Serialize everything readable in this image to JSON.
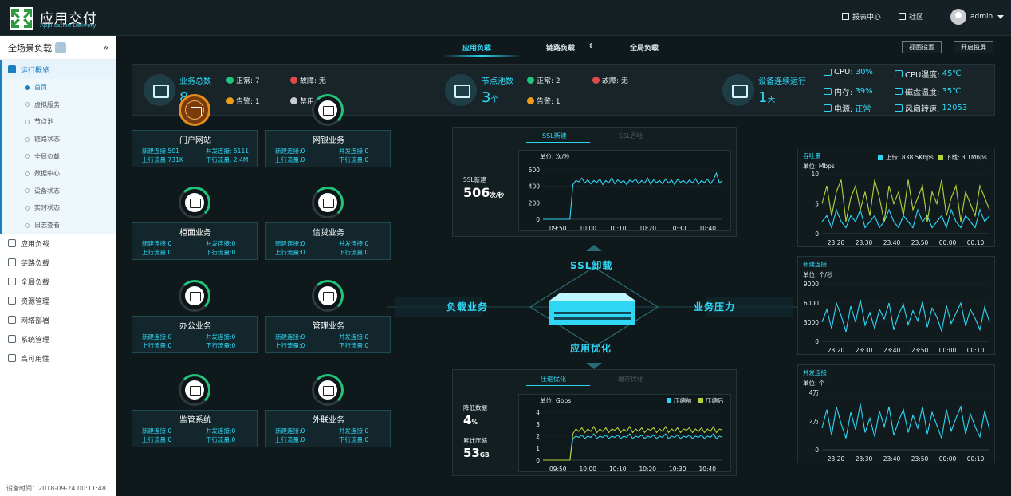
{
  "app": {
    "title": "应用交付",
    "subtitle": "Application Delivery"
  },
  "topbar": {
    "report": "报表中心",
    "community": "社区",
    "user": "admin"
  },
  "sidebar": {
    "header": "全场景负载",
    "collapse": "«",
    "groups": [
      {
        "label": "运行概览",
        "active": true
      },
      {
        "label": "应用负载"
      },
      {
        "label": "链路负载"
      },
      {
        "label": "全局负载"
      },
      {
        "label": "资源管理"
      },
      {
        "label": "网络部署"
      },
      {
        "label": "系统管理"
      },
      {
        "label": "高可用性"
      }
    ],
    "subitems": [
      "首页",
      "虚拟服务",
      "节点池",
      "链路状态",
      "全局负载",
      "数据中心",
      "设备状态",
      "实时状态",
      "日志查看"
    ],
    "footer": "设备时间：2018-09-24 00:11:48"
  },
  "tabs": {
    "app": "应用负载",
    "link": "链路负载",
    "global": "全局负载",
    "btn_view": "视图设置",
    "btn_screen": "开启投屏"
  },
  "stats": {
    "biz_label": "业务总数",
    "biz_value": "8",
    "biz_unit": "个",
    "normal": "正常: 7",
    "fault": "故障: 无",
    "warn": "告警: 1",
    "disabled": "禁用: 无",
    "pool_label": "节点池数",
    "pool_value": "3",
    "pool_unit": "个",
    "pool_normal": "正常: 2",
    "pool_fault": "故障: 无",
    "pool_warn": "告警: 1",
    "uptime_label": "设备连续运行",
    "uptime_value": "1",
    "uptime_unit": "天",
    "cpu_label": "CPU:",
    "cpu_value": "30%",
    "cputemp_label": "CPU温度:",
    "cputemp_value": "45℃",
    "mem_label": "内存:",
    "mem_value": "39%",
    "disk_label": "磁盘温度:",
    "disk_value": "35℃",
    "power_label": "电源:",
    "power_value": "正常",
    "fan_label": "风扇转速:",
    "fan_value": "12053"
  },
  "business": [
    {
      "name": "门户网站",
      "l1": "新建连接:501",
      "l2": "并发连接: 5111",
      "l3": "上行流量:731K",
      "l4": "下行流量: 2.4M"
    },
    {
      "name": "网银业务",
      "l1": "新建连接:0",
      "l2": "并发连接:0",
      "l3": "上行流量:0",
      "l4": "下行流量:0"
    },
    {
      "name": "柜面业务",
      "l1": "新建连接:0",
      "l2": "并发连接:0",
      "l3": "上行流量:0",
      "l4": "下行流量:0"
    },
    {
      "name": "信贷业务",
      "l1": "新建连接:0",
      "l2": "并发连接:0",
      "l3": "上行流量:0",
      "l4": "下行流量:0"
    },
    {
      "name": "办公业务",
      "l1": "新建连接:0",
      "l2": "并发连接:0",
      "l3": "上行流量:0",
      "l4": "下行流量:0"
    },
    {
      "name": "管理业务",
      "l1": "新建连接:0",
      "l2": "并发连接:0",
      "l3": "上行流量:0",
      "l4": "下行流量:0"
    },
    {
      "name": "监管系统",
      "l1": "新建连接:0",
      "l2": "并发连接:0",
      "l3": "上行流量:0",
      "l4": "下行流量:0"
    },
    {
      "name": "外联业务",
      "l1": "新建连接:0",
      "l2": "并发连接:0",
      "l3": "上行流量:0",
      "l4": "下行流量:0"
    }
  ],
  "center": {
    "ssl_tab_on": "SSL新建",
    "ssl_tab_off": "SSL吞吐",
    "ssl_label": "SSL新建",
    "ssl_value": "506",
    "ssl_unit": "次/秒",
    "ssl_offload": "SSL卸载",
    "load_biz": "负载业务",
    "biz_pressure": "业务压力",
    "app_opt": "应用优化",
    "comp_tab_on": "压缩优化",
    "comp_tab_off": "缓存优化",
    "reduce_label": "降低数据",
    "reduce_value": "4",
    "reduce_unit": "%",
    "total_label": "累计压缩",
    "total_value": "53",
    "total_unit": "GB"
  },
  "right": {
    "throughput_title": "吞吐量",
    "throughput_unit": "单位: Mbps",
    "up_legend": "上传: 838.5Kbps",
    "down_legend": "下载: 3.1Mbps",
    "newconn_title": "新建连接",
    "newconn_unit": "单位: 个/秒",
    "concur_title": "并发连接",
    "concur_unit": "单位: 个"
  },
  "colors": {
    "accent": "#2fd7f5",
    "green": "#22c37a",
    "yellow": "#b7d33b",
    "warn": "#f09c1a",
    "fault": "#e04a4a"
  },
  "chart_data": [
    {
      "type": "line",
      "title": "SSL新建",
      "ylabel": "单位: 次/秒",
      "ylim": [
        0,
        600
      ],
      "yticks": [
        0,
        200,
        400,
        600
      ],
      "xticks": [
        "09:50",
        "10:00",
        "10:10",
        "10:20",
        "10:30",
        "10:40"
      ],
      "series": [
        {
          "values": [
            0,
            0,
            0,
            0,
            0,
            0,
            0,
            0,
            0,
            0,
            420,
            470,
            455,
            500,
            440,
            480,
            430,
            470,
            445,
            490,
            420,
            470,
            440,
            505,
            430,
            480,
            445,
            470,
            420,
            475,
            455,
            490,
            430,
            470,
            440,
            500,
            425,
            480,
            445,
            470,
            430,
            490,
            440,
            475,
            420,
            485,
            450,
            470,
            430,
            480,
            440,
            495,
            425,
            470,
            445,
            490,
            430,
            480,
            560,
            440,
            470
          ]
        }
      ]
    },
    {
      "type": "line",
      "ylabel": "单位: Gbps",
      "ylim": [
        0,
        4
      ],
      "yticks": [
        0,
        1,
        2,
        3,
        4
      ],
      "xticks": [
        "09:50",
        "10:00",
        "10:10",
        "10:20",
        "10:30",
        "10:40"
      ],
      "series": [
        {
          "name": "压缩前",
          "values": [
            0,
            0,
            0,
            0,
            0,
            0,
            0,
            0,
            0,
            0,
            1.8,
            2.0,
            1.9,
            2.1,
            1.8,
            2.0,
            1.9,
            2.2,
            1.8,
            2.0,
            1.9,
            2.1,
            1.8,
            2.0,
            1.9,
            2.1,
            1.8,
            2.0,
            1.9,
            2.2,
            1.8,
            2.0,
            1.9,
            2.1,
            1.8,
            2.0,
            1.9,
            2.1,
            1.8,
            2.0,
            1.9,
            2.2,
            1.8,
            2.0,
            1.9,
            2.1,
            1.8,
            2.0,
            1.9,
            2.1,
            1.8,
            2.0,
            1.9,
            2.1,
            1.8,
            2.0,
            1.9,
            2.2,
            1.8,
            2.0,
            1.9
          ]
        },
        {
          "name": "压缩后",
          "values": [
            0,
            0,
            0,
            0,
            0,
            0,
            0,
            0,
            0,
            0,
            2.2,
            2.6,
            2.4,
            2.7,
            2.3,
            2.6,
            2.4,
            2.8,
            2.3,
            2.6,
            2.4,
            2.7,
            2.3,
            2.6,
            2.5,
            2.7,
            2.3,
            2.6,
            2.4,
            2.8,
            2.3,
            2.6,
            2.4,
            2.7,
            2.3,
            2.6,
            2.5,
            2.7,
            2.3,
            2.6,
            2.4,
            2.8,
            2.3,
            2.6,
            2.4,
            2.7,
            2.3,
            2.6,
            2.5,
            2.7,
            2.3,
            2.6,
            2.4,
            2.7,
            2.3,
            2.6,
            2.4,
            2.8,
            2.3,
            2.6,
            2.5
          ]
        }
      ]
    },
    {
      "type": "line",
      "title": "吞吐量",
      "ylabel": "单位: Mbps",
      "ylim": [
        0,
        10
      ],
      "yticks": [
        0,
        5,
        10
      ],
      "xticks": [
        "23:20",
        "23:30",
        "23:40",
        "23:50",
        "00:00",
        "00:10"
      ],
      "series": [
        {
          "name": "上传: 838.5Kbps",
          "values": [
            2,
            3,
            1,
            4,
            2,
            1,
            3,
            2,
            4,
            1,
            2,
            3,
            1,
            2,
            4,
            2,
            1,
            3,
            2,
            1,
            4,
            2,
            3,
            1,
            2,
            3,
            1,
            4,
            2,
            1,
            3,
            2,
            1,
            4,
            2,
            3
          ]
        },
        {
          "name": "下载: 3.1Mbps",
          "values": [
            5,
            8,
            3,
            7,
            9,
            2,
            6,
            8,
            4,
            7,
            3,
            9,
            6,
            2,
            8,
            5,
            7,
            3,
            9,
            4,
            6,
            8,
            2,
            7,
            5,
            9,
            3,
            6,
            8,
            2,
            7,
            5,
            3,
            8,
            6,
            4
          ]
        }
      ]
    },
    {
      "type": "line",
      "title": "新建连接",
      "ylabel": "单位: 个/秒",
      "ylim": [
        0,
        9000
      ],
      "yticks": [
        0,
        3000,
        6000,
        9000
      ],
      "xticks": [
        "23:20",
        "23:30",
        "23:40",
        "23:50",
        "00:00",
        "00:10"
      ],
      "series": [
        {
          "values": [
            3000,
            5000,
            2000,
            6000,
            4000,
            1500,
            5500,
            3000,
            6500,
            2500,
            4500,
            2000,
            5000,
            3500,
            6000,
            1800,
            4200,
            5800,
            2600,
            4800,
            3200,
            6200,
            2200,
            5200,
            3800,
            1600,
            5600,
            2800,
            4400,
            6000,
            2400,
            5000,
            3600,
            1800,
            5400,
            3000
          ]
        }
      ]
    },
    {
      "type": "line",
      "title": "并发连接",
      "ylabel": "单位: 个",
      "ylim": [
        0,
        40000
      ],
      "yticks": [
        0,
        20000,
        40000
      ],
      "yticklabels": [
        "0",
        "2万",
        "4万"
      ],
      "xticks": [
        "23:20",
        "23:30",
        "23:40",
        "23:50",
        "00:00",
        "00:10"
      ],
      "series": [
        {
          "values": [
            15000,
            28000,
            10000,
            30000,
            18000,
            8000,
            26000,
            14000,
            32000,
            12000,
            22000,
            9000,
            27000,
            16000,
            30000,
            10000,
            20000,
            28000,
            12000,
            24000,
            15000,
            30000,
            11000,
            26000,
            17000,
            8000,
            28000,
            13000,
            22000,
            30000,
            11000,
            25000,
            16000,
            9000,
            27000,
            14000
          ]
        }
      ]
    }
  ]
}
